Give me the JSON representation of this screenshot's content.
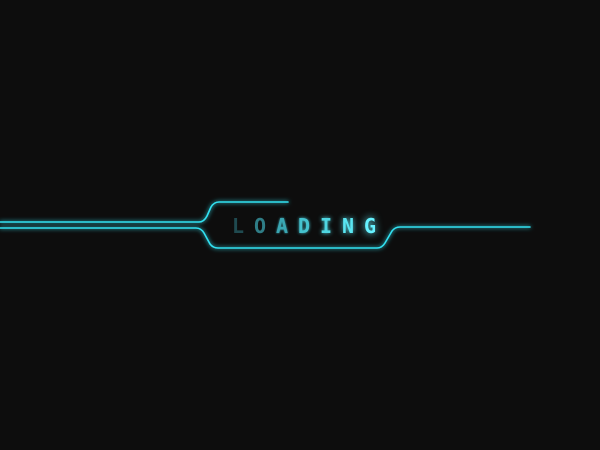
{
  "screen": {
    "background": "#0d0d0d",
    "accent": "#31e2f2"
  },
  "loader": {
    "letters": [
      "L",
      "O",
      "A",
      "D",
      "I",
      "N",
      "G"
    ],
    "letter_colors": [
      "#1f4a50",
      "#2f7d86",
      "#3aa6b2",
      "#45c3cf",
      "#4fd6e2",
      "#5ae6f2",
      "#66f2ff"
    ],
    "letter_glow": [
      "0",
      "0",
      "2px",
      "3px",
      "4px",
      "6px",
      "8px"
    ]
  },
  "circuit": {
    "segments": [
      "upper-left-line",
      "lower-left-line",
      "top-bump",
      "right-line",
      "right-short",
      "lower-right-line",
      "far-right-stub"
    ]
  }
}
